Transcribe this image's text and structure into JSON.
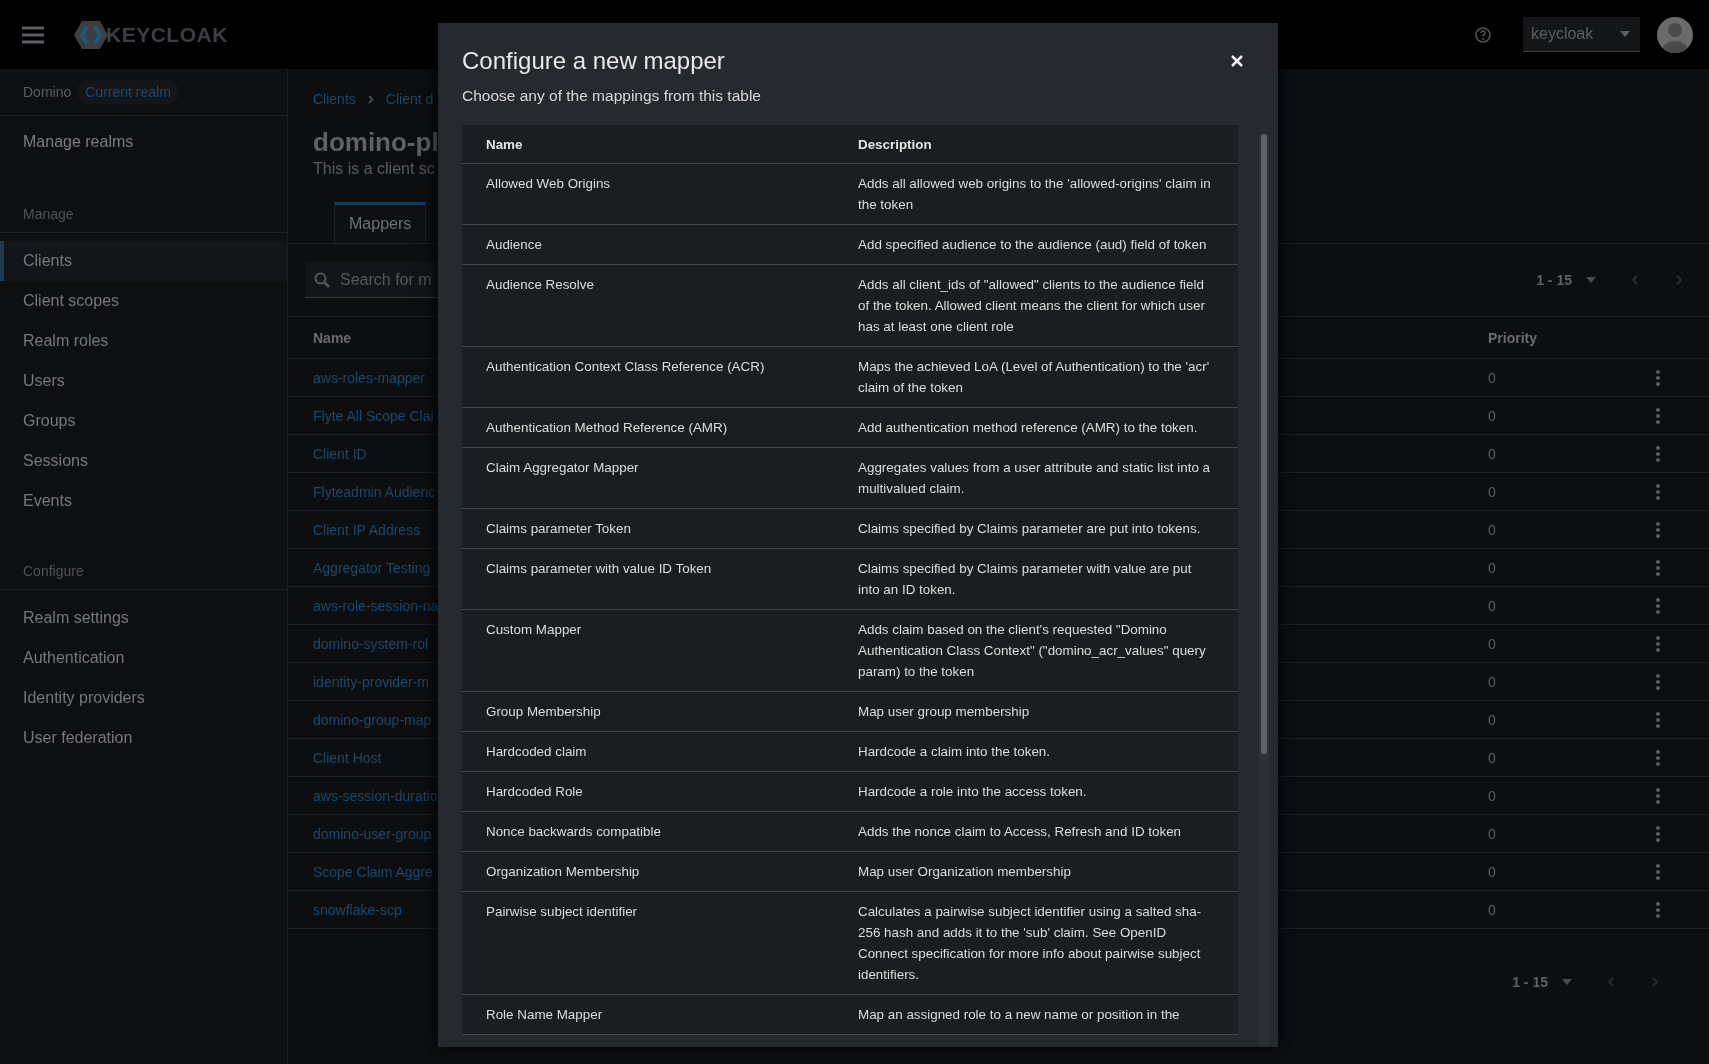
{
  "header": {
    "logo_text": "KEYCLOAK",
    "user_menu": "keycloak"
  },
  "sidebar": {
    "realm": "Domino",
    "realm_badge": "Current realm",
    "manage_realms": "Manage realms",
    "sections": [
      {
        "title": "Manage",
        "items": [
          {
            "label": "Clients",
            "selected": true
          },
          {
            "label": "Client scopes",
            "selected": false
          },
          {
            "label": "Realm roles",
            "selected": false
          },
          {
            "label": "Users",
            "selected": false
          },
          {
            "label": "Groups",
            "selected": false
          },
          {
            "label": "Sessions",
            "selected": false
          },
          {
            "label": "Events",
            "selected": false
          }
        ]
      },
      {
        "title": "Configure",
        "items": [
          {
            "label": "Realm settings",
            "selected": false
          },
          {
            "label": "Authentication",
            "selected": false
          },
          {
            "label": "Identity providers",
            "selected": false
          },
          {
            "label": "User federation",
            "selected": false
          }
        ]
      }
    ]
  },
  "main": {
    "breadcrumb": [
      "Clients",
      "Client d"
    ],
    "title": "domino-pl",
    "subtitle": "This is a client sc",
    "tabs": [
      {
        "label": "Mappers",
        "selected": true
      }
    ],
    "search": {
      "placeholder": "Search for m"
    },
    "pagination": "1 - 15",
    "table": {
      "columns": [
        "Name",
        "Priority"
      ],
      "rows": [
        {
          "name": "aws-roles-mapper",
          "priority": "0"
        },
        {
          "name": "Flyte All Scope Clai",
          "priority": "0"
        },
        {
          "name": "Client ID",
          "priority": "0"
        },
        {
          "name": "Flyteadmin Audienc",
          "priority": "0"
        },
        {
          "name": "Client IP Address",
          "priority": "0"
        },
        {
          "name": "Aggregator Testing",
          "priority": "0"
        },
        {
          "name": "aws-role-session-na",
          "priority": "0"
        },
        {
          "name": "domino-system-rol",
          "priority": "0"
        },
        {
          "name": "identity-provider-m",
          "priority": "0"
        },
        {
          "name": "domino-group-map",
          "priority": "0"
        },
        {
          "name": "Client Host",
          "priority": "0"
        },
        {
          "name": "aws-session-duratio",
          "priority": "0"
        },
        {
          "name": "domino-user-group",
          "priority": "0"
        },
        {
          "name": "Scope Claim Aggre",
          "priority": "0"
        },
        {
          "name": "snowflake-scp",
          "priority": "0"
        }
      ]
    },
    "bottom_pagination": "1 - 15"
  },
  "modal": {
    "title": "Configure a new mapper",
    "subtitle": "Choose any of the mappings from this table",
    "columns": [
      "Name",
      "Description"
    ],
    "rows": [
      {
        "name": "Allowed Web Origins",
        "description": "Adds all allowed web origins to the 'allowed-origins' claim in the token"
      },
      {
        "name": "Audience",
        "description": "Add specified audience to the audience (aud) field of token"
      },
      {
        "name": "Audience Resolve",
        "description": "Adds all client_ids of \"allowed\" clients to the audience field of the token. Allowed client means the client for which user has at least one client role"
      },
      {
        "name": "Authentication Context Class Reference (ACR)",
        "description": "Maps the achieved LoA (Level of Authentication) to the 'acr' claim of the token"
      },
      {
        "name": "Authentication Method Reference (AMR)",
        "description": "Add authentication method reference (AMR) to the token."
      },
      {
        "name": "Claim Aggregator Mapper",
        "description": "Aggregates values from a user attribute and static list into a multivalued claim."
      },
      {
        "name": "Claims parameter Token",
        "description": "Claims specified by Claims parameter are put into tokens."
      },
      {
        "name": "Claims parameter with value ID Token",
        "description": "Claims specified by Claims parameter with value are put into an ID token."
      },
      {
        "name": "Custom Mapper",
        "description": "Adds claim based on the client's requested \"Domino Authentication Class Context\" (\"domino_acr_values\" query param) to the token"
      },
      {
        "name": "Group Membership",
        "description": "Map user group membership"
      },
      {
        "name": "Hardcoded claim",
        "description": "Hardcode a claim into the token."
      },
      {
        "name": "Hardcoded Role",
        "description": "Hardcode a role into the access token."
      },
      {
        "name": "Nonce backwards compatible",
        "description": "Adds the nonce claim to Access, Refresh and ID token"
      },
      {
        "name": "Organization Membership",
        "description": "Map user Organization membership"
      },
      {
        "name": "Pairwise subject identifier",
        "description": "Calculates a pairwise subject identifier using a salted sha-256 hash and adds it to the 'sub' claim. See OpenID Connect specification for more info about pairwise subject identifiers."
      },
      {
        "name": "Role Name Mapper",
        "description": "Map an assigned role to a new name or position in the"
      }
    ]
  }
}
